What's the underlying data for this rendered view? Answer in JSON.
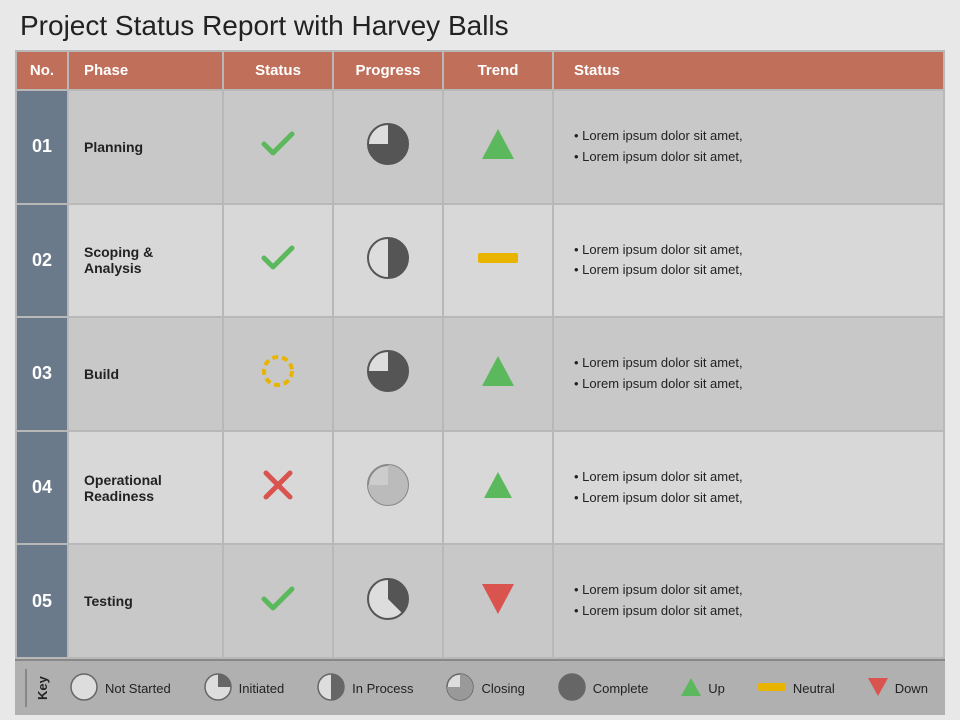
{
  "title": "Project Status Report with Harvey Balls",
  "header": {
    "cols": [
      "No.",
      "Phase",
      "Status",
      "Progress",
      "Trend",
      "Status"
    ]
  },
  "rows": [
    {
      "no": "01",
      "phase": "Planning",
      "status_icon": "check",
      "progress_type": "three_quarter",
      "trend_type": "up_green",
      "status_text": [
        "Lorem ipsum dolor sit amet,",
        "Lorem ipsum dolor sit amet,"
      ]
    },
    {
      "no": "02",
      "phase": "Scoping & Analysis",
      "status_icon": "check",
      "progress_type": "half",
      "trend_type": "neutral",
      "status_text": [
        "Lorem ipsum dolor sit amet,",
        "Lorem ipsum dolor sit amet,"
      ]
    },
    {
      "no": "03",
      "phase": "Build",
      "status_icon": "circle_yellow",
      "progress_type": "three_quarter_dark",
      "trend_type": "up_green",
      "status_text": [
        "Lorem ipsum dolor sit amet,",
        "Lorem ipsum dolor sit amet,"
      ]
    },
    {
      "no": "04",
      "phase": "Operational Readiness",
      "status_icon": "cross",
      "progress_type": "three_quarter_light",
      "trend_type": "up_green_sm",
      "status_text": [
        "Lorem ipsum dolor sit amet,",
        "Lorem ipsum dolor sit amet,"
      ]
    },
    {
      "no": "05",
      "phase": "Testing",
      "status_icon": "check",
      "progress_type": "quarter_left",
      "trend_type": "down_red",
      "status_text": [
        "Lorem ipsum dolor sit amet,",
        "Lorem ipsum dolor sit amet,"
      ]
    }
  ],
  "legend": {
    "key_label": "Key",
    "items": [
      {
        "label": "Not Started",
        "type": "not_started"
      },
      {
        "label": "Initiated",
        "type": "initiated"
      },
      {
        "label": "In Process",
        "type": "in_process"
      },
      {
        "label": "Closing",
        "type": "closing"
      },
      {
        "label": "Complete",
        "type": "complete"
      },
      {
        "label": "Up",
        "type": "up"
      },
      {
        "label": "Neutral",
        "type": "neutral"
      },
      {
        "label": "Down",
        "type": "down"
      }
    ]
  }
}
